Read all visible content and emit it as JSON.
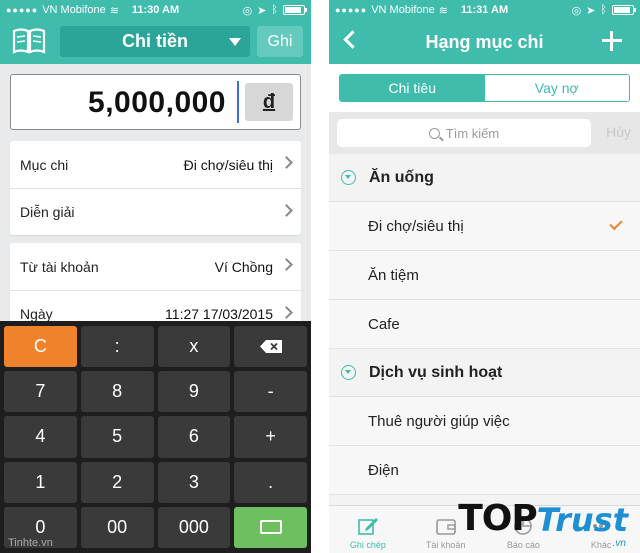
{
  "status_left": {
    "carrier": "VN Mobifone",
    "time": "11:30 AM"
  },
  "status_right": {
    "carrier": "VN Mobifone",
    "time": "11:31 AM"
  },
  "left": {
    "title": "Chi tiền",
    "save_label": "Ghi",
    "amount": "5,000,000",
    "currency": "đ",
    "rows_group1": [
      {
        "label": "Mục chi",
        "value": "Đi chợ/siêu thị"
      },
      {
        "label": "Diễn giải",
        "value": ""
      }
    ],
    "rows_group2": [
      {
        "label": "Từ tài khoản",
        "value": "Ví Chồng"
      },
      {
        "label": "Ngày",
        "value": "11:27 17/03/2015"
      }
    ],
    "keys": [
      "C",
      ":",
      "x",
      "",
      "7",
      "8",
      "9",
      "-",
      "4",
      "5",
      "6",
      "+",
      "1",
      "2",
      "3",
      ".",
      "0",
      "00",
      "000",
      ""
    ],
    "watermark": "Tinhte.vn"
  },
  "right": {
    "title": "Hạng mục chi",
    "segments": [
      "Chi tiêu",
      "Vay nợ"
    ],
    "search_placeholder": "Tìm kiếm",
    "cancel_label": "Hủy",
    "groups": [
      {
        "name": "Ăn uống",
        "items": [
          "Đi chợ/siêu thị",
          "Ăn tiệm",
          "Cafe"
        ]
      },
      {
        "name": "Dịch vụ sinh hoạt",
        "items": [
          "Thuê người giúp việc",
          "Điện"
        ]
      }
    ],
    "tabs": [
      "Ghi chép",
      "Tài khoản",
      "Báo cáo",
      "Khác"
    ],
    "logo": {
      "top": "TOP",
      "trust": "Trust",
      "vn": ".vn"
    }
  },
  "colors": {
    "accent": "#3fbcac",
    "accent_dark": "#2aa597",
    "orange": "#f0822b",
    "green": "#6dbf5f"
  }
}
